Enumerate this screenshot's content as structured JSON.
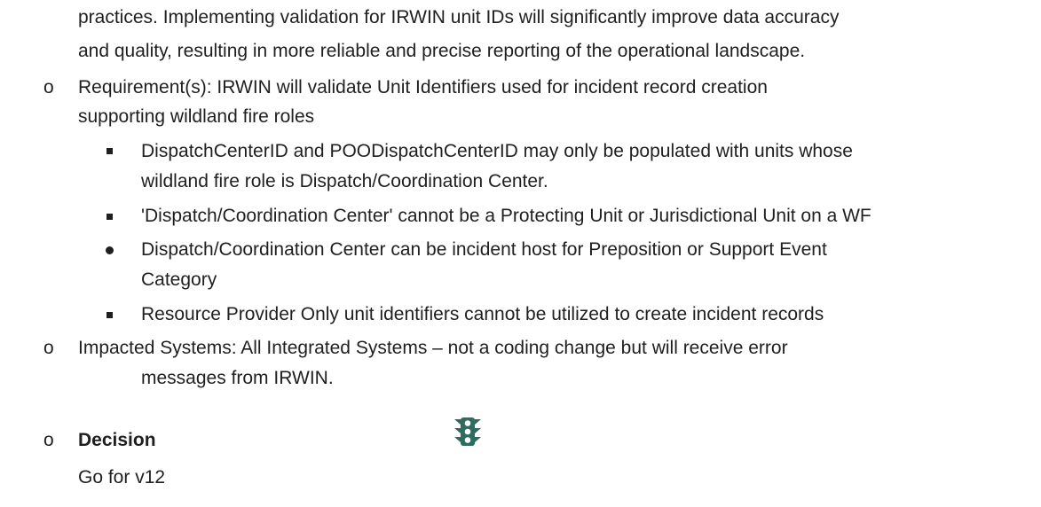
{
  "continuation": {
    "line1": "practices. Implementing validation for IRWIN unit IDs will significantly improve data accuracy",
    "line2": "and quality, resulting in more reliable and precise reporting of the operational landscape."
  },
  "requirements": {
    "bullet": "o",
    "line1": "Requirement(s): IRWIN will validate Unit Identifiers used for incident record creation",
    "line2": "supporting wildland fire roles",
    "items": [
      {
        "line1": "DispatchCenterID and POODispatchCenterID may only be populated with units whose",
        "line2": "wildland fire role is Dispatch/Coordination Center."
      },
      {
        "line1": "'Dispatch/Coordination Center' cannot be a Protecting Unit or Jurisdictional Unit on a WF"
      },
      {
        "line1": "Dispatch/Coordination Center can be incident host for Preposition or Support Event",
        "line2": "Category"
      },
      {
        "line1": "Resource Provider Only unit identifiers cannot be utilized to create incident records"
      }
    ]
  },
  "impacted": {
    "bullet": "o",
    "line1": "Impacted Systems: All Integrated Systems – not a coding change but will receive error",
    "line2": "messages from IRWIN."
  },
  "decision": {
    "bullet": "o",
    "label": "Decision",
    "icon": "traffic-light-icon",
    "value": "Go for v12"
  },
  "colors": {
    "text": "#1f1f1f",
    "icon": "#2f6b5e"
  }
}
